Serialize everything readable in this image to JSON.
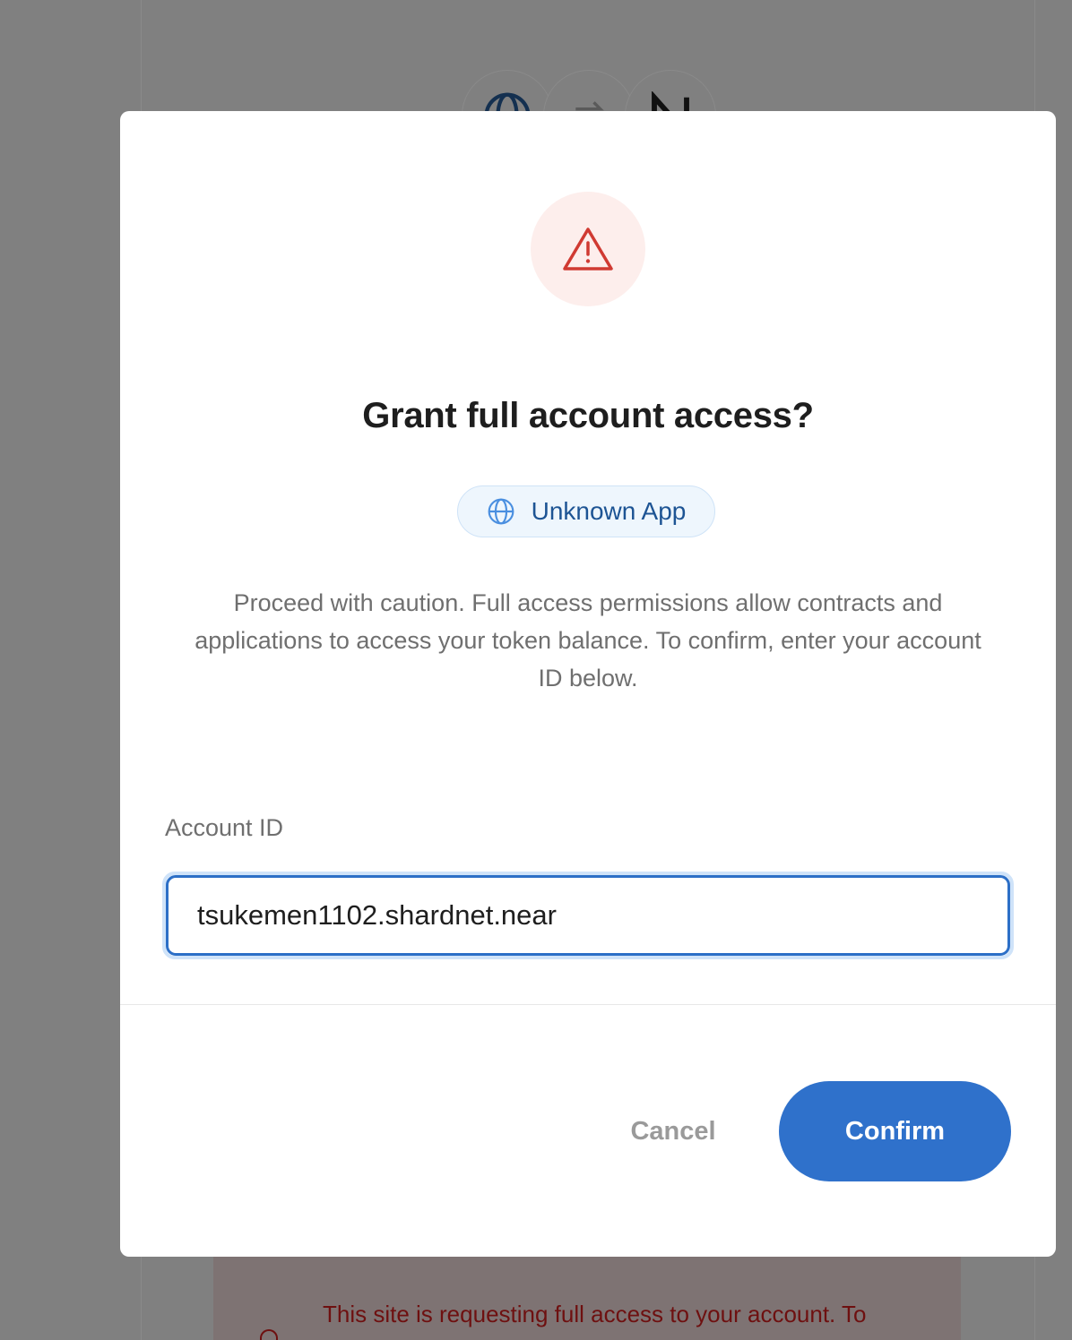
{
  "background": {
    "warning_text": "This site is requesting full access to your account. To"
  },
  "modal": {
    "title": "Grant full account access?",
    "app_name": "Unknown App",
    "description": "Proceed with caution. Full access permissions allow contracts and applications to access your token balance. To confirm, enter your account ID below.",
    "account_field": {
      "label": "Account ID",
      "value": "tsukemen1102.shardnet.near"
    },
    "cancel_label": "Cancel",
    "confirm_label": "Confirm"
  },
  "colors": {
    "primary": "#2f71cb",
    "warning": "#d03a32",
    "warning_bg": "#fdeeec",
    "overlay": "#808080"
  },
  "icons": {
    "warning": "warning-triangle-icon",
    "app": "globe-icon",
    "background_app": "globe-icon",
    "background_arrow": "swap-arrows-icon",
    "background_near": "near-logo-icon"
  }
}
